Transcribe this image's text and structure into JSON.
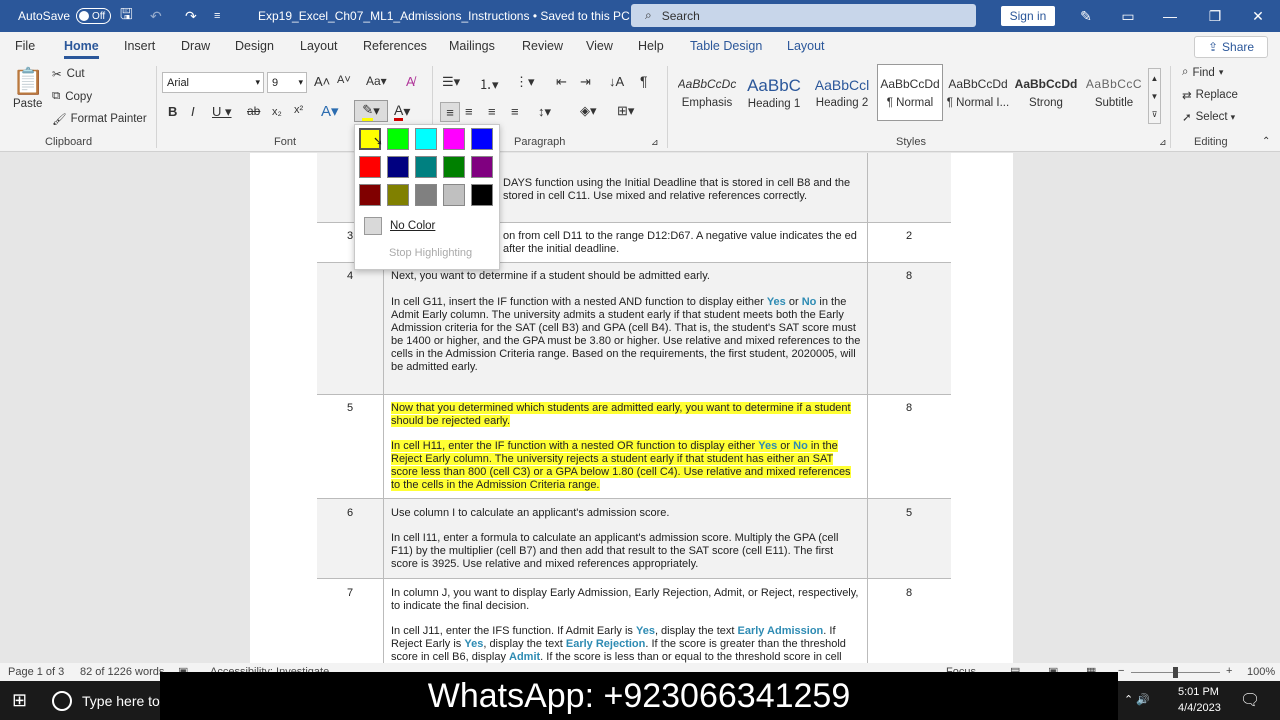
{
  "titlebar": {
    "autosave_label": "AutoSave",
    "autosave_state": "Off",
    "doc_title": "Exp19_Excel_Ch07_ML1_Admissions_Instructions  •  Saved to this PC",
    "search_placeholder": "Search",
    "signin_label": "Sign in"
  },
  "tabs": [
    "File",
    "Home",
    "Insert",
    "Draw",
    "Design",
    "Layout",
    "References",
    "Mailings",
    "Review",
    "View",
    "Help",
    "Table Design",
    "Layout"
  ],
  "share_label": "Share",
  "clipboard": {
    "paste": "Paste",
    "cut": "Cut",
    "copy": "Copy",
    "format_painter": "Format Painter",
    "group": "Clipboard"
  },
  "font": {
    "name": "Arial",
    "size": "9",
    "group": "Font"
  },
  "paragraph": {
    "group": "Paragraph"
  },
  "styles": {
    "group": "Styles",
    "items": [
      {
        "preview": "AaBbCcDc",
        "label": "Emphasis"
      },
      {
        "preview": "AaBbC",
        "label": "Heading 1"
      },
      {
        "preview": "AaBbCcl",
        "label": "Heading 2"
      },
      {
        "preview": "AaBbCcDd",
        "label": "¶ Normal"
      },
      {
        "preview": "AaBbCcDd",
        "label": "¶ Normal I..."
      },
      {
        "preview": "AaBbCcDd",
        "label": "Strong"
      },
      {
        "preview": "AaBbCcC",
        "label": "Subtitle"
      }
    ]
  },
  "editing": {
    "find": "Find",
    "replace": "Replace",
    "select": "Select",
    "group": "Editing"
  },
  "palette": {
    "colors": [
      "#ffff00",
      "#00ff00",
      "#00ffff",
      "#ff00ff",
      "#0000ff",
      "#ff0000",
      "#000080",
      "#008080",
      "#008000",
      "#800080",
      "#800000",
      "#808000",
      "#808080",
      "#c0c0c0",
      "#000000"
    ],
    "no_color": "No Color",
    "stop": "Stop Highlighting"
  },
  "rows": [
    {
      "num": "",
      "pts": "",
      "text": "DAYS function using the Initial Deadline that is stored in cell B8 and the stored in cell C11. Use mixed and relative references correctly."
    },
    {
      "num": "3",
      "pts": "2",
      "text": "on from cell D11 to the range D12:D67. A negative value indicates the ed after the initial deadline."
    },
    {
      "num": "4",
      "pts": "8",
      "p1": "Next, you want to determine if a student should be admitted early.",
      "p2a": "In cell G11, insert the IF function with a nested AND function to display either ",
      "yes": "Yes",
      "or": " or ",
      "no": "No",
      "p2b": " in the Admit Early column. The university admits a student early if that student meets both the Early Admission criteria for the SAT (cell B3) and GPA (cell B4). That is, the student's SAT score must be 1400 or higher, and the GPA must be 3.80 or higher. Use relative and mixed references to the cells in the Admission Criteria range. Based on the requirements, the first student, 2020005, will be admitted early."
    },
    {
      "num": "5",
      "pts": "8",
      "p1": "Now that you determined which students are admitted early, you want to determine if a student should be rejected early.",
      "p2a": "In cell H11, enter the IF function with a nested OR function to display either ",
      "yes": "Yes",
      "or": " or ",
      "no": "No",
      "p2b": " in the Reject Early column. The university rejects a student early if that student has either an SAT score less than 800 (cell C3) or a GPA below 1.80 (cell C4). Use relative and mixed references to the cells in the Admission Criteria range."
    },
    {
      "num": "6",
      "pts": "5",
      "p1": "Use column I to calculate an applicant's admission score.",
      "p2": "In cell I11, enter a formula to calculate an applicant's admission score. Multiply the GPA (cell F11) by the multiplier (cell B7) and then add that result to the SAT score (cell E11). The first score is 3925. Use relative and mixed references appropriately."
    },
    {
      "num": "7",
      "pts": "8",
      "p1": "In column J, you want to display Early Admission, Early Rejection, Admit, or Reject, respectively, to indicate the final decision.",
      "p2a": "In cell J11, enter the IFS function. If Admit Early is ",
      "yes": "Yes",
      "p2b": ", display the text ",
      "ea": "Early Admission",
      "p2c": ". If Reject Early is ",
      "p2d": ", display the text ",
      "er": "Early Rejection",
      "p2e": ". If the score is greater than the threshold score in cell B6, display ",
      "ad": "Admit",
      "p2f": ". If the score is less than or equal to the threshold score in cell"
    }
  ],
  "status": {
    "page": "Page 1 of 3",
    "words": "82 of 1226 words",
    "accessibility": "Accessibility: Investigate",
    "focus": "Focus",
    "zoom": "100%"
  },
  "taskbar": {
    "search_placeholder": "Type here to",
    "time": "5:01 PM",
    "date": "4/4/2023"
  },
  "overlay": "WhatsApp: +923066341259"
}
